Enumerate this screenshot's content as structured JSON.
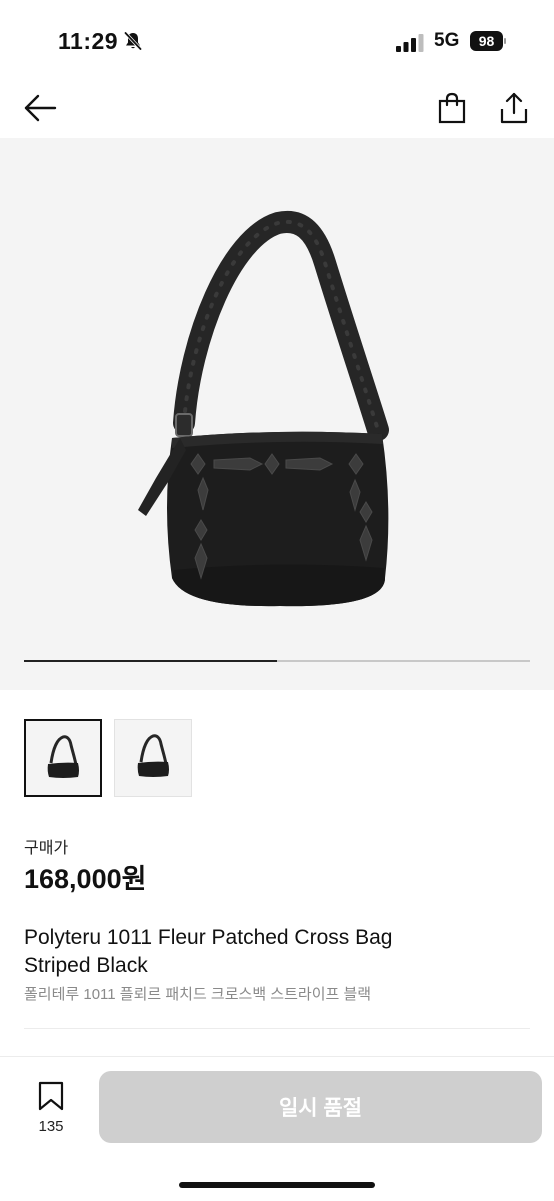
{
  "status_bar": {
    "time": "11:29",
    "network": "5G",
    "battery": "98",
    "icons": [
      "bell-slash-icon",
      "signal-icon",
      "battery-icon"
    ]
  },
  "nav": {
    "icons": [
      "arrow-left-icon",
      "shopping-bag-icon",
      "share-icon"
    ]
  },
  "gallery": {
    "image_count": 2,
    "current_image": 1,
    "progress_fraction": 0.5
  },
  "product": {
    "price_label": "구매가",
    "price": "168,000원",
    "title_en_line1": "Polyteru 1011 Fleur Patched Cross Bag",
    "title_en_line2": "Striped Black",
    "title_ko": "폴리테루 1011 플뢰르 패치드 크로스백 스트라이프 블랙"
  },
  "footer": {
    "wish_count": "135",
    "soldout_label": "일시 품절"
  },
  "colors": {
    "disabled_button": "#cfcfcf",
    "hero_background": "#f4f4f4",
    "muted_text": "#8a8a8a"
  }
}
